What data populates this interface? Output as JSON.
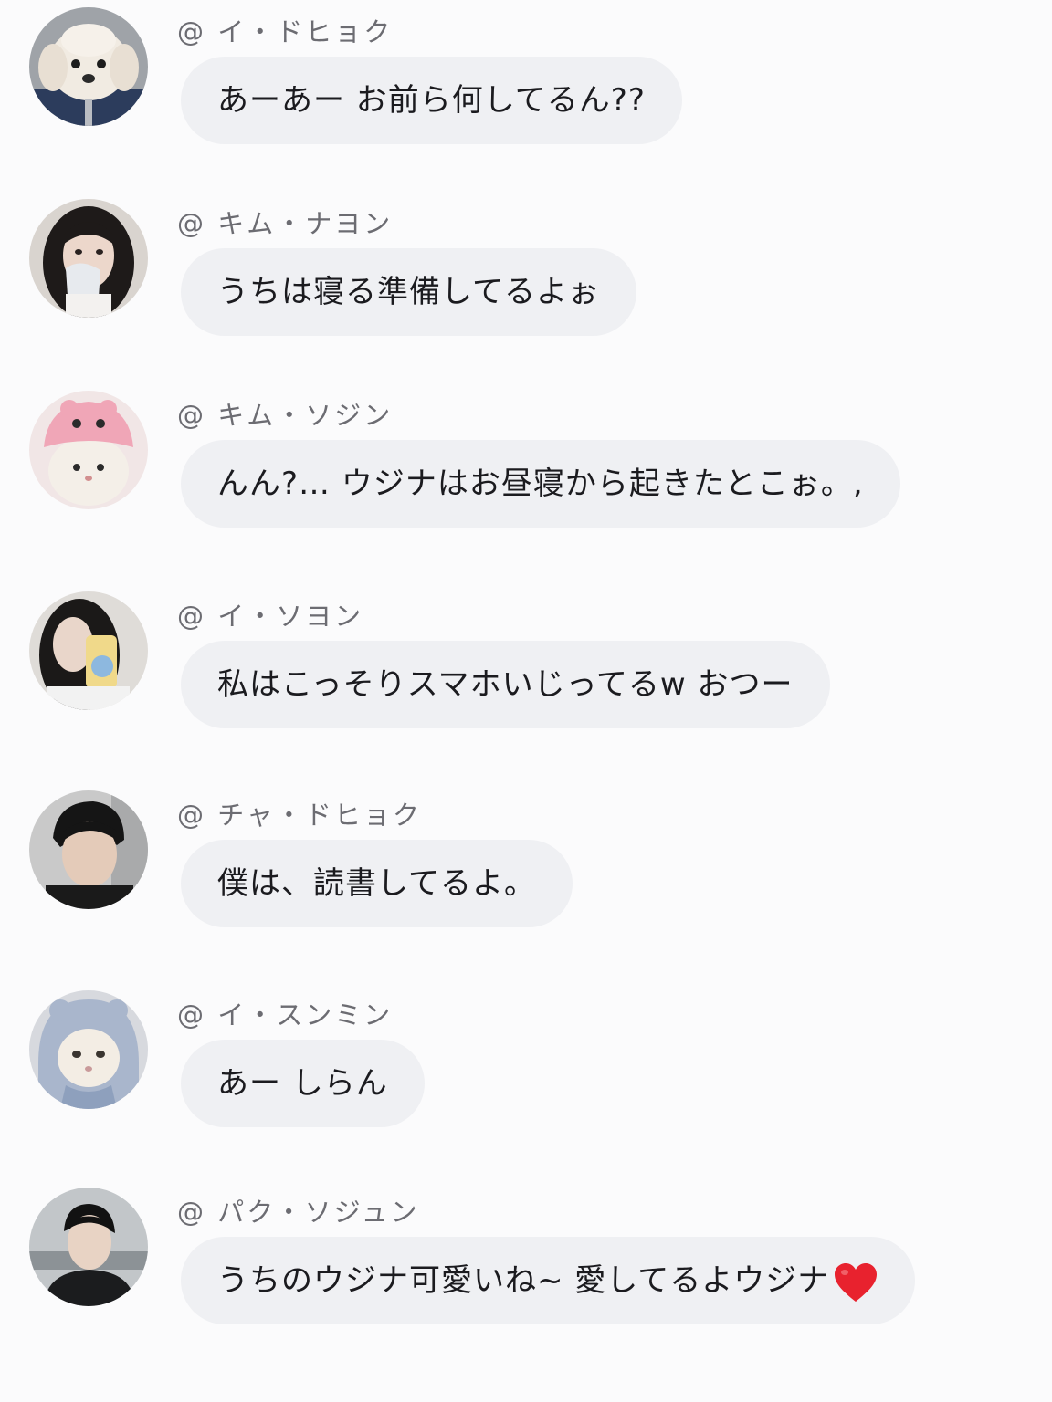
{
  "messages": [
    {
      "name": "@ イ・ドヒョク",
      "text": "あーあー お前ら何してるん??",
      "avatar_icon": "puppy-plush-avatar-icon"
    },
    {
      "name": "@ キム・ナヨン",
      "text": "うちは寝る準備してるよぉ",
      "avatar_icon": "girl-portrait-avatar-icon"
    },
    {
      "name": "@ キム・ソジン",
      "text": "んん?… ウジナはお昼寝から起きたとこぉ。,",
      "avatar_icon": "cat-pink-hat-avatar-icon"
    },
    {
      "name": "@ イ・ソヨン",
      "text": "私はこっそりスマホいじってるw おつー",
      "avatar_icon": "girl-phone-selfie-avatar-icon"
    },
    {
      "name": "@ チャ・ドヒョク",
      "text": "僕は、読書してるよ。",
      "avatar_icon": "boy-portrait-avatar-icon"
    },
    {
      "name": "@ イ・スンミン",
      "text": "あー しらん",
      "avatar_icon": "cat-blue-hood-avatar-icon"
    },
    {
      "name": "@ パク・ソジュン",
      "text": "うちのウジナ可愛いね~ 愛してるよウジナ",
      "avatar_icon": "boy-hoodie-avatar-icon",
      "emoji": "red-heart-icon"
    }
  ],
  "colors": {
    "background": "#fbfbfc",
    "bubble": "#eff0f3",
    "name_text": "#6c6c72",
    "message_text": "#1b1b1f",
    "heart": "#e8222e"
  }
}
